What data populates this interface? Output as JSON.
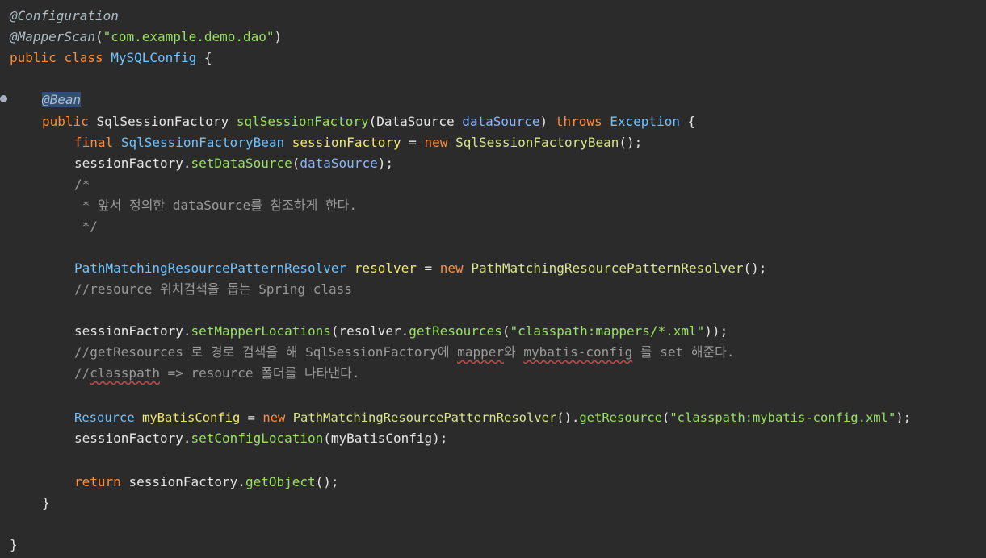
{
  "code": {
    "l1": {
      "ann": "@Configuration"
    },
    "l2": {
      "ann": "@MapperScan",
      "open": "(",
      "str": "\"com.example.demo.dao\"",
      "close": ")"
    },
    "l3": {
      "kw1": "public",
      "kw2": "class",
      "cls": "MySQLConfig",
      "brace": "{"
    },
    "l5": {
      "ann": "@Bean"
    },
    "l6": {
      "kw1": "public",
      "ret": "SqlSessionFactory",
      "name": "sqlSessionFactory",
      "open": "(",
      "ptype": "DataSource",
      "pname": "dataSource",
      "close": ")",
      "kw2": "throws",
      "exc": "Exception",
      "brace": "{"
    },
    "l7": {
      "kw1": "final",
      "type": "SqlSessionFactoryBean",
      "var": "sessionFactory",
      "eq": "=",
      "kw2": "new",
      "ctor": "SqlSessionFactoryBean",
      "tail": "();"
    },
    "l8": {
      "obj": "sessionFactory",
      "dot": ".",
      "fn": "setDataSource",
      "open": "(",
      "arg": "dataSource",
      "close": ");"
    },
    "l9": {
      "c": "/*"
    },
    "l10": {
      "c": " * 앞서 정의한 dataSource를 참조하게 한다."
    },
    "l11": {
      "c": " */"
    },
    "l13": {
      "type": "PathMatchingResourcePatternResolver",
      "var": "resolver",
      "eq": "=",
      "kw": "new",
      "ctor": "PathMatchingResourcePatternResolver",
      "tail": "();"
    },
    "l14": {
      "c": "//resource 위치검색을 돕는 Spring class"
    },
    "l16": {
      "obj": "sessionFactory",
      "dot": ".",
      "fn": "setMapperLocations",
      "open": "(",
      "obj2": "resolver",
      "dot2": ".",
      "fn2": "getResources",
      "open2": "(",
      "str": "\"classpath:mappers/*.xml\"",
      "close": "));"
    },
    "l17": {
      "c1": "//getResources 로 경로 검색을 해 SqlSessionFactory에 ",
      "w1": "mapper",
      "c2": "와 ",
      "w2": "mybatis-config",
      "c3": " 를 set 해준다."
    },
    "l18": {
      "c1": "//",
      "w1": "classpath",
      "c2": " => resource 폴더를 나타낸다."
    },
    "l20": {
      "type": "Resource",
      "var": "myBatisConfig",
      "eq": "=",
      "kw": "new",
      "ctor": "PathMatchingResourcePatternResolver",
      "mid": "().",
      "fn": "getResource",
      "open": "(",
      "str": "\"classpath:mybatis-config.xml\"",
      "close": ");"
    },
    "l21": {
      "obj": "sessionFactory",
      "dot": ".",
      "fn": "setConfigLocation",
      "open": "(",
      "arg": "myBatisConfig",
      "close": ");"
    },
    "l23": {
      "kw": "return",
      "obj": "sessionFactory",
      "dot": ".",
      "fn": "getObject",
      "tail": "();"
    },
    "l24": {
      "brace": "}"
    },
    "l26": {
      "brace": "}"
    }
  },
  "colors": {
    "background": "#2b2b2b",
    "keyword": "#ff8d3a",
    "string": "#98e35f",
    "type": "#6fc3ff",
    "comment": "#9a9a9a",
    "annotation": "#b0bec5",
    "variable": "#f1e86f"
  },
  "gutter": {
    "marker_icon": "breakpoint-dot-icon"
  }
}
